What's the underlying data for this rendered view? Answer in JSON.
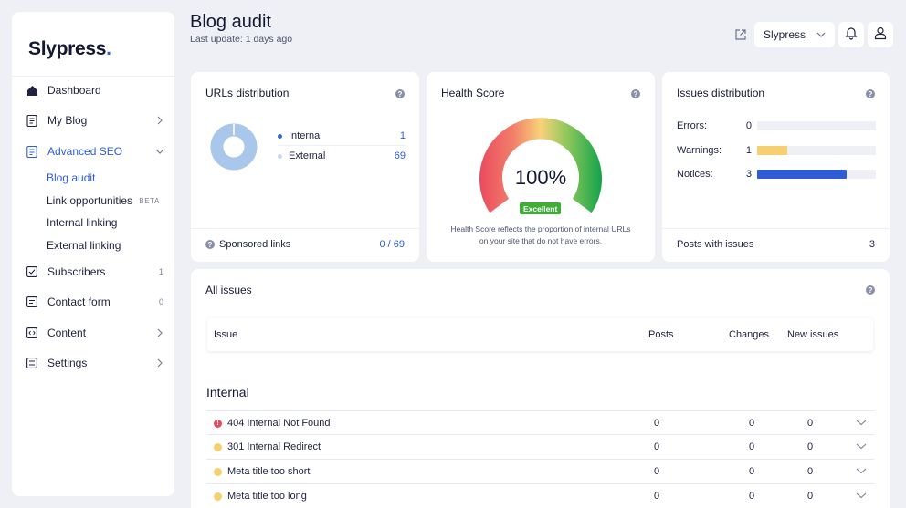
{
  "app": {
    "logo_text": "Slypress",
    "logo_dot": "."
  },
  "sidebar": {
    "items": [
      {
        "label": "Dashboard",
        "icon": "home-icon"
      },
      {
        "label": "My Blog",
        "icon": "document-icon"
      },
      {
        "label": "Advanced SEO",
        "icon": "seo-icon"
      },
      {
        "label": "Subscribers",
        "icon": "checkbox-icon",
        "count": "1"
      },
      {
        "label": "Contact form",
        "icon": "form-icon",
        "count": "0"
      },
      {
        "label": "Content",
        "icon": "code-icon"
      },
      {
        "label": "Settings",
        "icon": "settings-icon"
      }
    ],
    "sub_items": [
      {
        "label": "Blog audit"
      },
      {
        "label": "Link opportunities",
        "badge": "BETA"
      },
      {
        "label": "Internal linking"
      },
      {
        "label": "External linking"
      }
    ]
  },
  "header": {
    "title": "Blog audit",
    "subtitle": "Last update: 1 days ago",
    "site_select": "Slypress"
  },
  "urls_distribution": {
    "title": "URLs distribution",
    "legend": [
      {
        "label": "Internal",
        "value": "1",
        "color": "#2e6bd3"
      },
      {
        "label": "External",
        "value": "69",
        "color": "#c9daf0"
      }
    ],
    "footer_label": "Sponsored links",
    "footer_value": "0 / 69",
    "donut": {
      "internal": 1,
      "external": 69,
      "colors": [
        "#a8c7ea",
        "#ffffff"
      ]
    }
  },
  "health_score": {
    "title": "Health Score",
    "percent": "100%",
    "value": 100,
    "badge": "Excellent",
    "description": "Health Score reflects the proportion of internal URLs on your site that do not have errors."
  },
  "issues_distribution": {
    "title": "Issues distribution",
    "rows": [
      {
        "label": "Errors:",
        "count": "0",
        "fraction": 0,
        "color": "#e84a5f"
      },
      {
        "label": "Warnings:",
        "count": "1",
        "fraction": 0.25,
        "color": "#f6d06f"
      },
      {
        "label": "Notices:",
        "count": "3",
        "fraction": 0.75,
        "color": "#2e5bd8"
      }
    ],
    "footer_label": "Posts with issues",
    "footer_value": "3"
  },
  "all_issues": {
    "title": "All issues",
    "columns": [
      "Issue",
      "Posts",
      "Changes",
      "New issues"
    ],
    "section": "Internal",
    "rows": [
      {
        "name": "404 Internal Not Found",
        "severity": "error",
        "posts": "0",
        "changes": "0",
        "new": "0"
      },
      {
        "name": "301 Internal Redirect",
        "severity": "warning",
        "posts": "0",
        "changes": "0",
        "new": "0"
      },
      {
        "name": "Meta title too short",
        "severity": "warning",
        "posts": "0",
        "changes": "0",
        "new": "0"
      },
      {
        "name": "Meta title too long",
        "severity": "warning",
        "posts": "0",
        "changes": "0",
        "new": "0"
      }
    ]
  },
  "colors": {
    "accent": "#2e5bd8",
    "error": "#e84a5f",
    "warning": "#f6d06f",
    "success": "#3fae37"
  }
}
